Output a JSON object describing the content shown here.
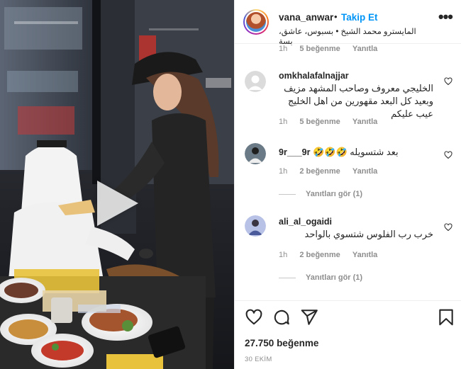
{
  "header": {
    "username": "vana_anwar",
    "separator": "•",
    "follow_label": "Takip Et",
    "location": "المايسترو محمد الشيخ • بسبوس، عاشق، بسة",
    "more_label": "•••"
  },
  "comments": [
    {
      "partial": true,
      "time": "1h",
      "likes": "5 beğenme",
      "reply": "Yanıtla"
    },
    {
      "username": "omkhalafalnajjar",
      "text": "الخليجي معروف وصاحب المشهد مزيف وبعيد كل البعد مقهورين من اهل الخليج عيب عليكم",
      "time": "1h",
      "likes": "5 beğenme",
      "reply": "Yanıtla",
      "avatar": "default-avatar"
    },
    {
      "username": "9r___9r",
      "text": "بعد شتسويله 🤣🤣🤣",
      "time": "1h",
      "likes": "2 beğenme",
      "reply": "Yanıtla",
      "view_replies": "Yanıtları gör (1)",
      "avatar": "person-avatar"
    },
    {
      "username": "ali_al_ogaidi",
      "text": "خرب رب الفلوس شتسوي بالواحد",
      "time": "1h",
      "likes": "2 beğenme",
      "reply": "Yanıtla",
      "view_replies": "Yanıtları gör (1)",
      "avatar": "person-avatar"
    }
  ],
  "actions": {
    "like_icon": "heart-icon",
    "comment_icon": "comment-icon",
    "share_icon": "share-icon",
    "save_icon": "bookmark-icon"
  },
  "post": {
    "likes_count": "27.750",
    "likes_label": "beğenme",
    "date": "30 EKİM"
  },
  "colors": {
    "accent": "#0095f6",
    "text": "#262626",
    "muted": "#8e8e8e",
    "border": "#efefef"
  }
}
